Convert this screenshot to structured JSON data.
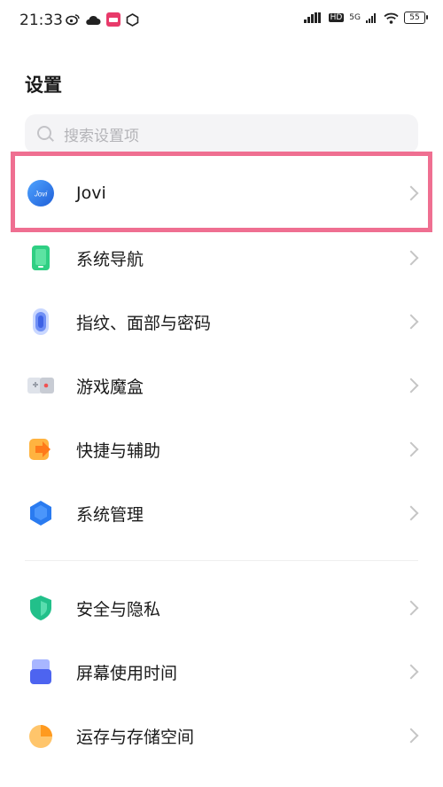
{
  "status_bar": {
    "time": "21:33",
    "network": "5G",
    "hd": "HD",
    "battery": "55"
  },
  "page": {
    "title": "设置"
  },
  "search": {
    "placeholder": "搜索设置项"
  },
  "items": [
    {
      "label": "Jovi",
      "icon": "jovi-icon",
      "highlighted": true
    },
    {
      "label": "系统导航",
      "icon": "system-navigation-icon"
    },
    {
      "label": "指纹、面部与密码",
      "icon": "fingerprint-icon"
    },
    {
      "label": "游戏魔盒",
      "icon": "game-box-icon"
    },
    {
      "label": "快捷与辅助",
      "icon": "shortcut-assist-icon"
    },
    {
      "label": "系统管理",
      "icon": "system-management-icon"
    },
    {
      "label": "安全与隐私",
      "icon": "security-privacy-icon"
    },
    {
      "label": "屏幕使用时间",
      "icon": "screen-time-icon"
    },
    {
      "label": "运存与存储空间",
      "icon": "storage-icon"
    }
  ],
  "colors": {
    "highlight_border": "#ef6f91",
    "accent_blue": "#2f7bf0"
  }
}
